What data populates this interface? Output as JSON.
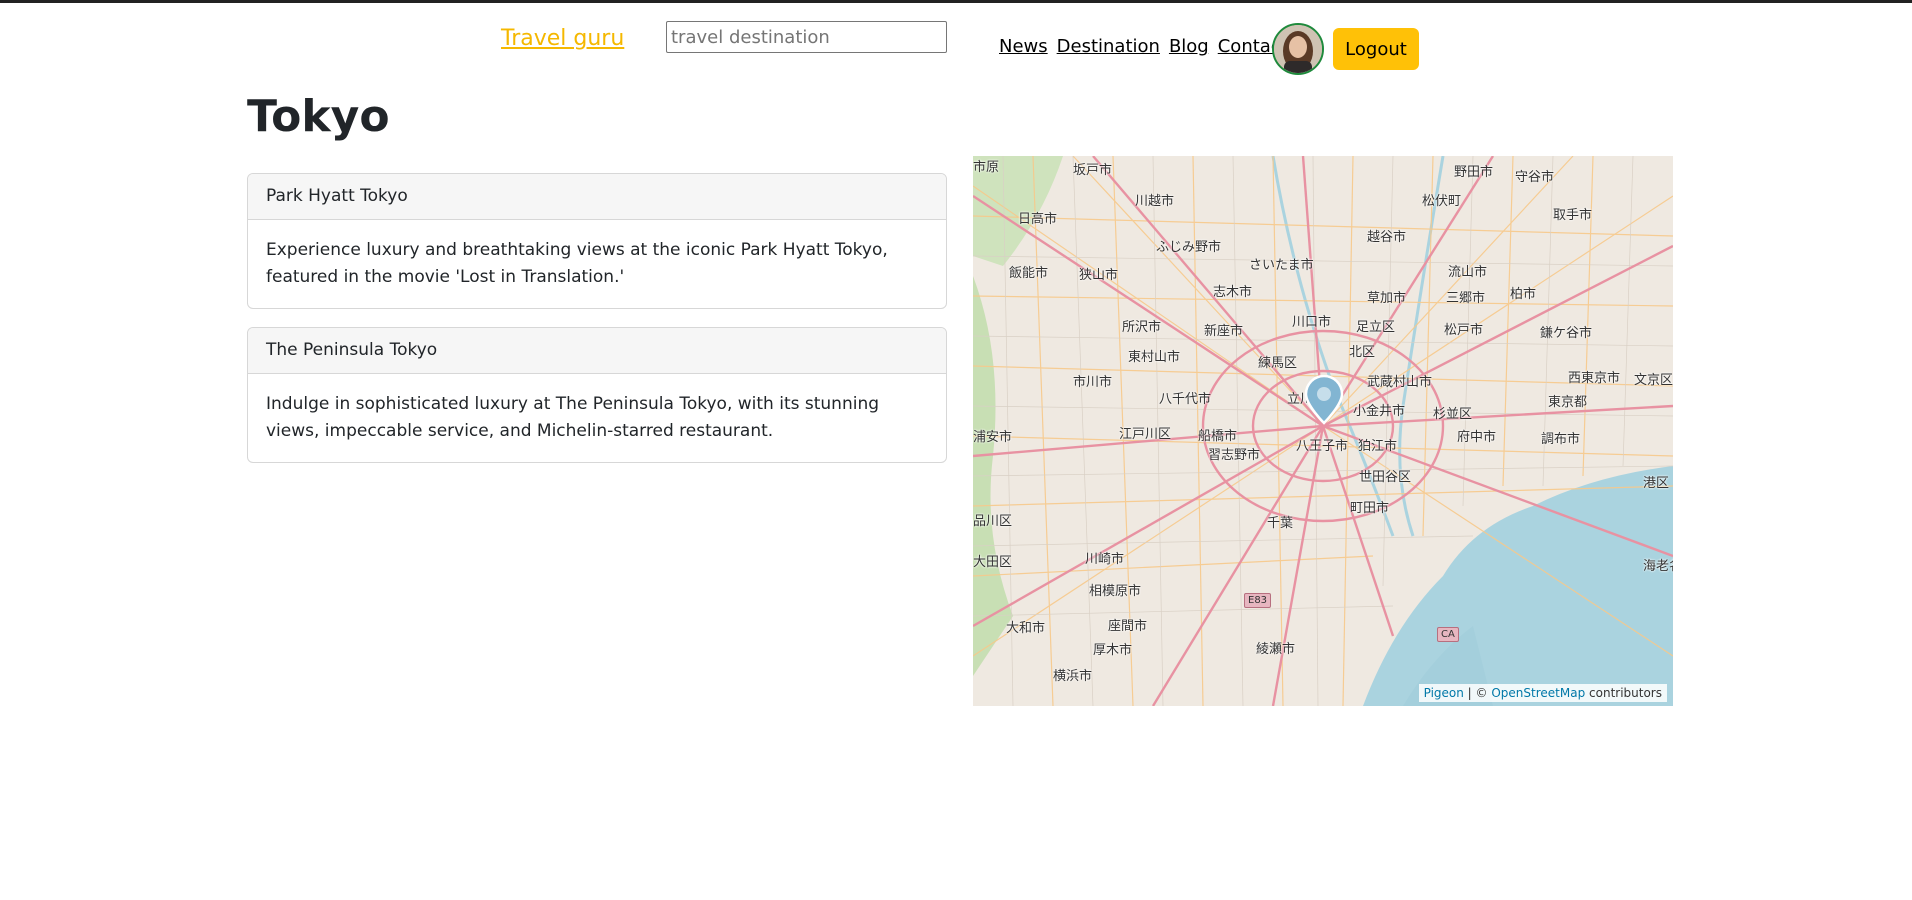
{
  "header": {
    "brand": "Travel guru",
    "search_placeholder": "travel destination",
    "nav": [
      "News",
      "Destination",
      "Blog",
      "Contact"
    ],
    "logout": "Logout"
  },
  "page": {
    "title": "Tokyo"
  },
  "cards": [
    {
      "title": "Park Hyatt Tokyo",
      "body": "Experience luxury and breathtaking views at the iconic Park Hyatt Tokyo, featured in the movie 'Lost in Translation.'"
    },
    {
      "title": "The Peninsula Tokyo",
      "body": "Indulge in sophisticated luxury at The Peninsula Tokyo, with its stunning views, impeccable service, and Michelin-starred restaurant."
    }
  ],
  "map": {
    "place_labels": [
      "坂戸市",
      "川越市",
      "日高市",
      "ふじみ野市",
      "さいたま市",
      "越谷市",
      "野田市",
      "守谷市",
      "松伏町",
      "取手市",
      "飯能市",
      "狭山市",
      "志木市",
      "草加市",
      "三郷市",
      "流山市",
      "柏市",
      "所沢市",
      "新座市",
      "川口市",
      "足立区",
      "松戸市",
      "鎌ケ谷市",
      "東村山市",
      "練馬区",
      "北区",
      "武蔵村山市",
      "西東京市",
      "文京区",
      "市川市",
      "八千代市",
      "立川市",
      "小金井市",
      "杉並区",
      "東京都",
      "江戸川区",
      "船橋市",
      "府中市",
      "調布市",
      "浦安市",
      "習志野市",
      "八王子市",
      "狛江市",
      "世田谷区",
      "港区",
      "品川区",
      "千葉",
      "町田市",
      "大田区",
      "川崎市",
      "相模原市",
      "座間市",
      "大和市",
      "厚木市",
      "綾瀬市",
      "横浜市",
      "海老名市",
      "市原"
    ],
    "road_badges": [
      "E83",
      "CA"
    ],
    "attribution_link1": "Pigeon",
    "attribution_sep": " | © ",
    "attribution_link2": "OpenStreetMap",
    "attribution_suffix": " contributors",
    "colors": {
      "land": "#efe9e1",
      "water": "#aad3df",
      "major_road": "#e892a2",
      "minor_road": "#f7c98b",
      "green": "#b9d8a5",
      "marker": "#82b5d2"
    }
  },
  "colors": {
    "brand": "#f5b800",
    "logout_bg": "#ffc107"
  }
}
